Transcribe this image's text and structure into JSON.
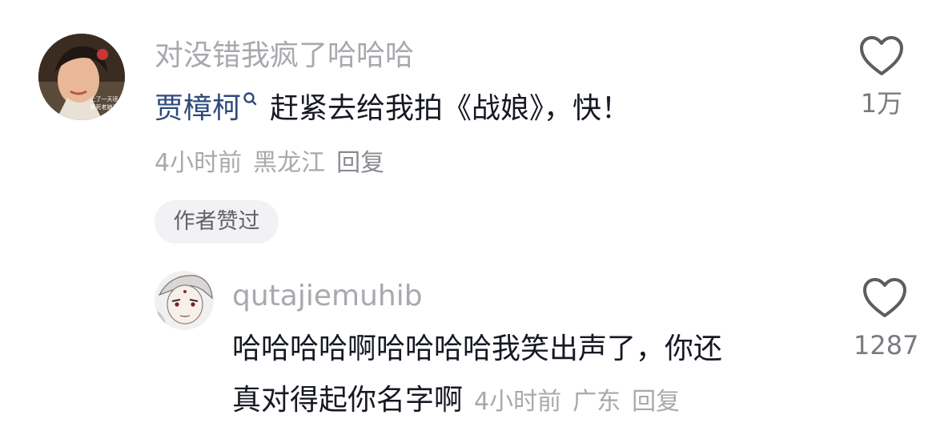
{
  "comment": {
    "username": "对没错我疯了哈哈哈",
    "mention": "贾樟柯",
    "text": "赶紧去给我拍《战娘》，快！",
    "time": "4小时前",
    "location": "黑龙江",
    "reply_label": "回复",
    "author_badge": "作者赞过",
    "likes": "1万"
  },
  "reply": {
    "username": "qutajiemuhib",
    "text_line1": "哈哈哈哈啊哈哈哈哈我笑出声了，你还",
    "text_line2": "真对得起你名字啊",
    "time": "4小时前",
    "location": "广东",
    "reply_label": "回复",
    "likes": "1287"
  },
  "avatar_overlay": {
    "line1": "上了一天班",
    "line2": "累死老娘了"
  },
  "icons": {
    "like": "heart-outline-icon",
    "mention": "search-icon"
  },
  "colors": {
    "mention": "#2f4a7c",
    "secondary_text": "#a8a9ae",
    "primary_text": "#161823",
    "badge_bg": "#f2f2f4"
  }
}
